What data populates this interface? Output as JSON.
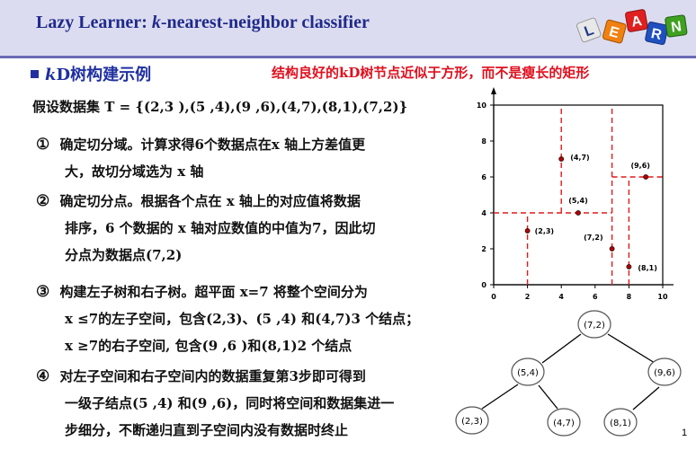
{
  "title": "Lazy Learner: k-nearest-neighbor classifier",
  "title_prefix": "Lazy Learner: ",
  "title_k": "k",
  "title_suffix": "-nearest-neighbor classifier",
  "logo_letters": [
    "L",
    "E",
    "A",
    "R",
    "N"
  ],
  "section": {
    "heading_k": "k",
    "heading_rest": "D树构建示例",
    "note": "结构良好的kD树节点近似于方形，而不是瘦长的矩形"
  },
  "dataset_line": "假设数据集 T = {(2,3 ),(5 ,4),(9 ,6),(4,7),(8,1),(7,2)}",
  "steps": [
    {
      "marker": "①",
      "lines": [
        "确定切分域。计算求得6个数据点在x 轴上方差值更",
        "大，故切分域选为 x 轴"
      ]
    },
    {
      "marker": "②",
      "lines": [
        "确定切分点。根据各个点在 x 轴上的对应值将数据",
        "排序，6 个数据的 x 轴对应数值的中值为7，因此切",
        "分点为数据点(7,2)"
      ]
    },
    {
      "marker": "③",
      "lines": [
        "构建左子树和右子树。超平面 x=7 将整个空间分为",
        "x ≤7的左子空间，包含(2,3)、(5 ,4) 和(4,7)3 个结点；",
        "x ≥7的右子空间, 包含(9 ,6 )和(8,1)2 个结点"
      ]
    },
    {
      "marker": "④",
      "lines": [
        "对左子空间和右子空间内的数据重复第3步即可得到",
        "一级子结点(5 ,4) 和(9 ,6)，同时将空间和数据集进一",
        "步细分，不断递归直到子空间内没有数据时终止"
      ]
    }
  ],
  "chart_data": {
    "type": "scatter",
    "xlim": [
      0,
      10
    ],
    "ylim": [
      0,
      10
    ],
    "x_ticks": [
      "0",
      "2",
      "4",
      "6",
      "8",
      "10"
    ],
    "y_ticks": [
      "0",
      "2",
      "4",
      "6",
      "8",
      "10"
    ],
    "points": [
      {
        "x": 2,
        "y": 3,
        "label": "(2,3)"
      },
      {
        "x": 4,
        "y": 7,
        "label": "(4,7)"
      },
      {
        "x": 5,
        "y": 4,
        "label": "(5,4)"
      },
      {
        "x": 7,
        "y": 2,
        "label": "(7,2)"
      },
      {
        "x": 9,
        "y": 6,
        "label": "(9,6)"
      },
      {
        "x": 8,
        "y": 1,
        "label": "(8,1)"
      }
    ],
    "splits": [
      {
        "axis": "x",
        "value": 7,
        "from": 0,
        "to": 10
      },
      {
        "axis": "y",
        "value": 4,
        "from": 0,
        "to": 7
      },
      {
        "axis": "y",
        "value": 6,
        "from": 7,
        "to": 10
      },
      {
        "axis": "x",
        "value": 2,
        "from": 0,
        "to": 4
      },
      {
        "axis": "x",
        "value": 4,
        "from": 4,
        "to": 10
      },
      {
        "axis": "x",
        "value": 8,
        "from": 0,
        "to": 6
      }
    ]
  },
  "tree": {
    "root": "(7,2)",
    "level1": [
      "(5,4)",
      "(9,6)"
    ],
    "level2": [
      "(2,3)",
      "(4,7)",
      "(8,1)"
    ]
  },
  "page_number": "1"
}
